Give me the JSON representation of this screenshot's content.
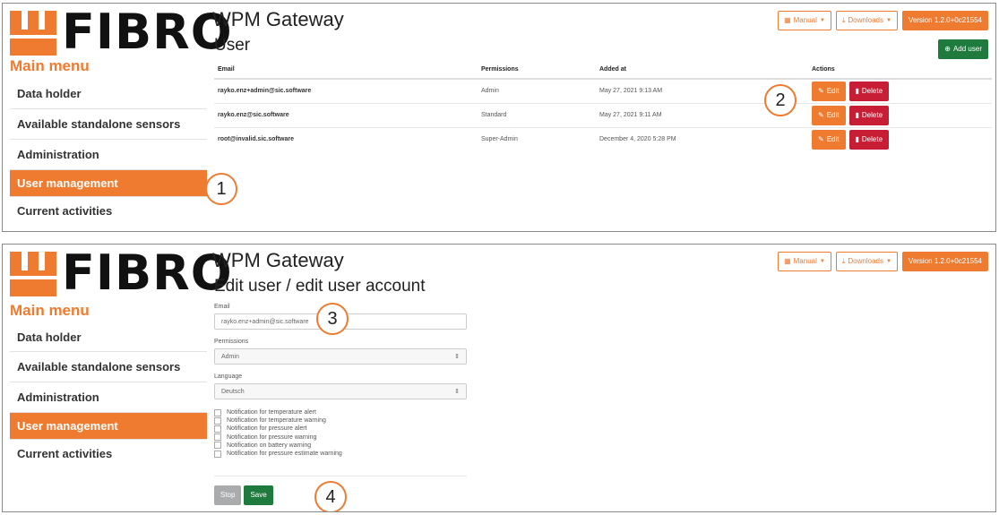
{
  "brand": {
    "logo_text": "FIBRO",
    "accent_color": "#ee7b30"
  },
  "header": {
    "app_title": "WPM Gateway",
    "manual_label": "Manual",
    "downloads_label": "Downloads",
    "version_label": "Version 1.2.0+0c21554"
  },
  "sidebar": {
    "title": "Main menu",
    "items": [
      {
        "label": "Data holder"
      },
      {
        "label": "Available standalone sensors"
      },
      {
        "label": "Administration"
      },
      {
        "label": "User management",
        "active": true
      },
      {
        "label": "Current activities"
      }
    ]
  },
  "user_list": {
    "title": "User",
    "add_user_label": "Add user",
    "columns": [
      "Email",
      "Permissions",
      "Added at",
      "Actions"
    ],
    "rows": [
      {
        "email": "rayko.enz+admin@sic.software",
        "permissions": "Admin",
        "added_at": "May 27, 2021 9:13 AM"
      },
      {
        "email": "rayko.enz@sic.software",
        "permissions": "Standard",
        "added_at": "May 27, 2021 9:11 AM"
      },
      {
        "email": "root@invalid.sic.software",
        "permissions": "Super-Admin",
        "added_at": "December 4, 2020 5:28 PM"
      }
    ],
    "edit_label": "Edit",
    "delete_label": "Delete"
  },
  "edit_user": {
    "title": "Edit user / edit user account",
    "email_label": "Email",
    "email_value": "rayko.enz+admin@sic.software",
    "permissions_label": "Permissions",
    "permissions_value": "Admin",
    "language_label": "Language",
    "language_value": "Deutsch",
    "notifications": [
      "Notification for temperature alert",
      "Notification for temperature warning",
      "Notification for pressure alert",
      "Notification for pressure warning",
      "Notification on battery warning",
      "Notification for pressure estimate warning"
    ],
    "stop_label": "Stop",
    "save_label": "Save"
  },
  "callouts": [
    "1",
    "2",
    "3",
    "4"
  ]
}
